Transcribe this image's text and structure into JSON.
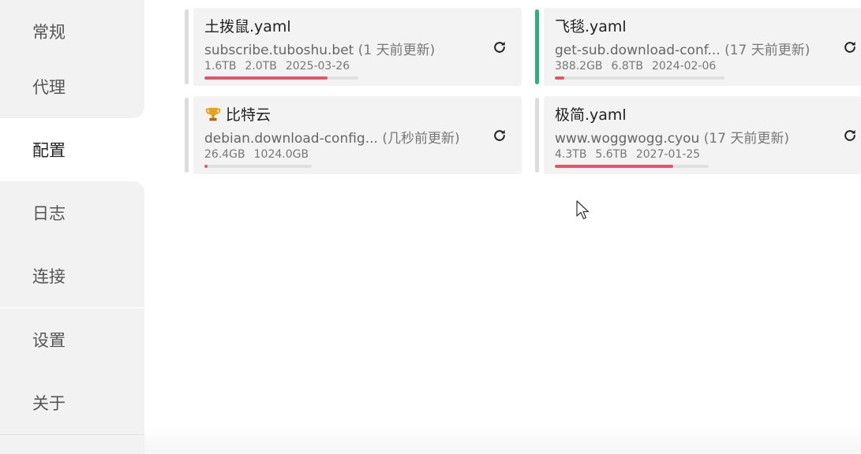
{
  "sidebar": {
    "items": [
      {
        "label": "常规"
      },
      {
        "label": "代理"
      },
      {
        "label": "配置",
        "active": true
      },
      {
        "label": "日志"
      },
      {
        "label": "连接"
      },
      {
        "label": "设置"
      },
      {
        "label": "关于"
      }
    ]
  },
  "profiles": [
    {
      "name": "土拨鼠.yaml",
      "url": "subscribe.tuboshu.bet",
      "updated": "(1 天前更新)",
      "used": "1.6TB",
      "total": "2.0TB",
      "expire": "2025-03-26",
      "usage_fraction": 0.8,
      "selected": false,
      "icon": "refresh-icon"
    },
    {
      "name": "飞毯.yaml",
      "url": "get-sub.download-conf...",
      "updated": "(17 天前更新)",
      "used": "388.2GB",
      "total": "6.8TB",
      "expire": "2024-02-06",
      "usage_fraction": 0.056,
      "selected": true,
      "icon": "refresh-icon"
    },
    {
      "name": "比特云",
      "title_icon": "trophy-icon",
      "url": "debian.download-config...",
      "updated": "(几秒前更新)",
      "used": "26.4GB",
      "total": "1024.0GB",
      "expire": "",
      "usage_fraction": 0.026,
      "selected": false,
      "icon": "refresh-icon"
    },
    {
      "name": "极简.yaml",
      "url": "www.woggwogg.cyou",
      "updated": "(17 天前更新)",
      "used": "4.3TB",
      "total": "5.6TB",
      "expire": "2027-01-25",
      "usage_fraction": 0.77,
      "selected": false,
      "icon": "refresh-icon"
    }
  ],
  "colors": {
    "selected_accent": "#3aab78",
    "usage_fill": "#e0566a",
    "usage_track": "#e0e0e0",
    "card_bg": "#f3f3f3",
    "sidebar_bg": "#f2f2f2"
  }
}
